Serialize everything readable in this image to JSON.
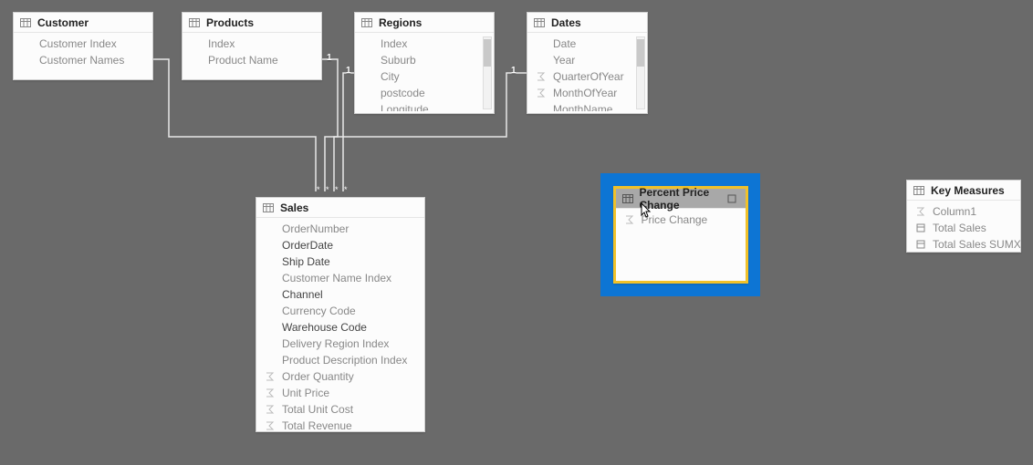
{
  "tables": {
    "customer": {
      "title": "Customer",
      "cols": [
        "Customer Index",
        "Customer Names"
      ]
    },
    "products": {
      "title": "Products",
      "cols": [
        "Index",
        "Product Name"
      ]
    },
    "regions": {
      "title": "Regions",
      "cols": [
        "Index",
        "Suburb",
        "City",
        "postcode",
        "Longitude"
      ]
    },
    "dates": {
      "title": "Dates",
      "cols": [
        "Date",
        "Year",
        "QuarterOfYear",
        "MonthOfYear",
        "MonthName"
      ]
    },
    "sales": {
      "title": "Sales",
      "cols": [
        "OrderNumber",
        "OrderDate",
        "Ship Date",
        "Customer Name Index",
        "Channel",
        "Currency Code",
        "Warehouse Code",
        "Delivery Region Index",
        "Product Description Index",
        "Order Quantity",
        "Unit Price",
        "Total Unit Cost",
        "Total Revenue"
      ]
    },
    "percent": {
      "title": "Percent Price Change",
      "cols": [
        "Price Change"
      ]
    },
    "key": {
      "title": "Key Measures",
      "cols": [
        "Column1",
        "Total Sales",
        "Total Sales SUMX"
      ]
    }
  },
  "cardinality": {
    "one": "1"
  },
  "stars": "* * * *"
}
